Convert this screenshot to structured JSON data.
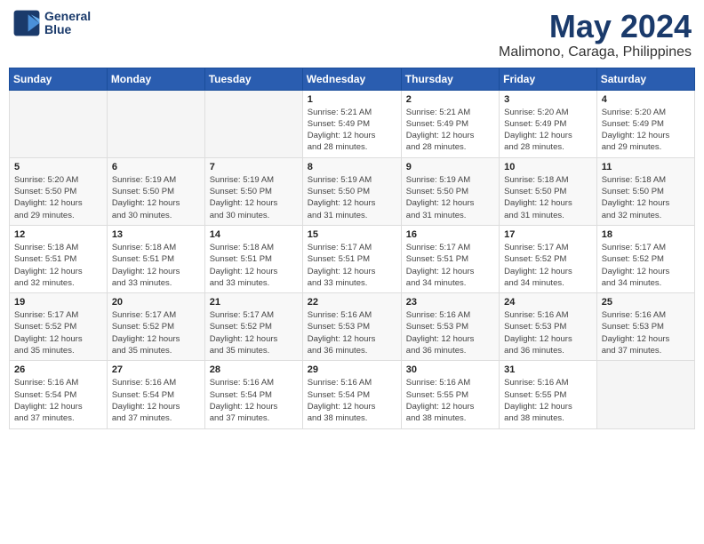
{
  "header": {
    "logo_line1": "General",
    "logo_line2": "Blue",
    "month": "May 2024",
    "location": "Malimono, Caraga, Philippines"
  },
  "weekdays": [
    "Sunday",
    "Monday",
    "Tuesday",
    "Wednesday",
    "Thursday",
    "Friday",
    "Saturday"
  ],
  "weeks": [
    [
      {
        "day": "",
        "info": ""
      },
      {
        "day": "",
        "info": ""
      },
      {
        "day": "",
        "info": ""
      },
      {
        "day": "1",
        "info": "Sunrise: 5:21 AM\nSunset: 5:49 PM\nDaylight: 12 hours\nand 28 minutes."
      },
      {
        "day": "2",
        "info": "Sunrise: 5:21 AM\nSunset: 5:49 PM\nDaylight: 12 hours\nand 28 minutes."
      },
      {
        "day": "3",
        "info": "Sunrise: 5:20 AM\nSunset: 5:49 PM\nDaylight: 12 hours\nand 28 minutes."
      },
      {
        "day": "4",
        "info": "Sunrise: 5:20 AM\nSunset: 5:49 PM\nDaylight: 12 hours\nand 29 minutes."
      }
    ],
    [
      {
        "day": "5",
        "info": "Sunrise: 5:20 AM\nSunset: 5:50 PM\nDaylight: 12 hours\nand 29 minutes."
      },
      {
        "day": "6",
        "info": "Sunrise: 5:19 AM\nSunset: 5:50 PM\nDaylight: 12 hours\nand 30 minutes."
      },
      {
        "day": "7",
        "info": "Sunrise: 5:19 AM\nSunset: 5:50 PM\nDaylight: 12 hours\nand 30 minutes."
      },
      {
        "day": "8",
        "info": "Sunrise: 5:19 AM\nSunset: 5:50 PM\nDaylight: 12 hours\nand 31 minutes."
      },
      {
        "day": "9",
        "info": "Sunrise: 5:19 AM\nSunset: 5:50 PM\nDaylight: 12 hours\nand 31 minutes."
      },
      {
        "day": "10",
        "info": "Sunrise: 5:18 AM\nSunset: 5:50 PM\nDaylight: 12 hours\nand 31 minutes."
      },
      {
        "day": "11",
        "info": "Sunrise: 5:18 AM\nSunset: 5:50 PM\nDaylight: 12 hours\nand 32 minutes."
      }
    ],
    [
      {
        "day": "12",
        "info": "Sunrise: 5:18 AM\nSunset: 5:51 PM\nDaylight: 12 hours\nand 32 minutes."
      },
      {
        "day": "13",
        "info": "Sunrise: 5:18 AM\nSunset: 5:51 PM\nDaylight: 12 hours\nand 33 minutes."
      },
      {
        "day": "14",
        "info": "Sunrise: 5:18 AM\nSunset: 5:51 PM\nDaylight: 12 hours\nand 33 minutes."
      },
      {
        "day": "15",
        "info": "Sunrise: 5:17 AM\nSunset: 5:51 PM\nDaylight: 12 hours\nand 33 minutes."
      },
      {
        "day": "16",
        "info": "Sunrise: 5:17 AM\nSunset: 5:51 PM\nDaylight: 12 hours\nand 34 minutes."
      },
      {
        "day": "17",
        "info": "Sunrise: 5:17 AM\nSunset: 5:52 PM\nDaylight: 12 hours\nand 34 minutes."
      },
      {
        "day": "18",
        "info": "Sunrise: 5:17 AM\nSunset: 5:52 PM\nDaylight: 12 hours\nand 34 minutes."
      }
    ],
    [
      {
        "day": "19",
        "info": "Sunrise: 5:17 AM\nSunset: 5:52 PM\nDaylight: 12 hours\nand 35 minutes."
      },
      {
        "day": "20",
        "info": "Sunrise: 5:17 AM\nSunset: 5:52 PM\nDaylight: 12 hours\nand 35 minutes."
      },
      {
        "day": "21",
        "info": "Sunrise: 5:17 AM\nSunset: 5:52 PM\nDaylight: 12 hours\nand 35 minutes."
      },
      {
        "day": "22",
        "info": "Sunrise: 5:16 AM\nSunset: 5:53 PM\nDaylight: 12 hours\nand 36 minutes."
      },
      {
        "day": "23",
        "info": "Sunrise: 5:16 AM\nSunset: 5:53 PM\nDaylight: 12 hours\nand 36 minutes."
      },
      {
        "day": "24",
        "info": "Sunrise: 5:16 AM\nSunset: 5:53 PM\nDaylight: 12 hours\nand 36 minutes."
      },
      {
        "day": "25",
        "info": "Sunrise: 5:16 AM\nSunset: 5:53 PM\nDaylight: 12 hours\nand 37 minutes."
      }
    ],
    [
      {
        "day": "26",
        "info": "Sunrise: 5:16 AM\nSunset: 5:54 PM\nDaylight: 12 hours\nand 37 minutes."
      },
      {
        "day": "27",
        "info": "Sunrise: 5:16 AM\nSunset: 5:54 PM\nDaylight: 12 hours\nand 37 minutes."
      },
      {
        "day": "28",
        "info": "Sunrise: 5:16 AM\nSunset: 5:54 PM\nDaylight: 12 hours\nand 37 minutes."
      },
      {
        "day": "29",
        "info": "Sunrise: 5:16 AM\nSunset: 5:54 PM\nDaylight: 12 hours\nand 38 minutes."
      },
      {
        "day": "30",
        "info": "Sunrise: 5:16 AM\nSunset: 5:55 PM\nDaylight: 12 hours\nand 38 minutes."
      },
      {
        "day": "31",
        "info": "Sunrise: 5:16 AM\nSunset: 5:55 PM\nDaylight: 12 hours\nand 38 minutes."
      },
      {
        "day": "",
        "info": ""
      }
    ]
  ]
}
